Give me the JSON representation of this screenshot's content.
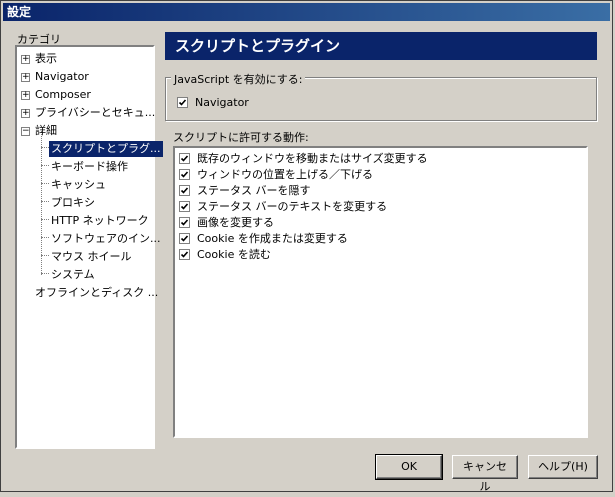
{
  "window": {
    "title": "設定"
  },
  "category_label": "カテゴリ",
  "tree": {
    "items": [
      {
        "label": "表示",
        "expander": "+"
      },
      {
        "label": "Navigator",
        "expander": "+"
      },
      {
        "label": "Composer",
        "expander": "+"
      },
      {
        "label": "プライバシーとセキュ...",
        "expander": "+"
      },
      {
        "label": "詳細",
        "expander": "−"
      },
      {
        "label": "スクリプトとプラグ..."
      },
      {
        "label": "キーボード操作"
      },
      {
        "label": "キャッシュ"
      },
      {
        "label": "プロキシ"
      },
      {
        "label": "HTTP ネットワーク"
      },
      {
        "label": "ソフトウェアのイン..."
      },
      {
        "label": "マウス ホイール"
      },
      {
        "label": "システム"
      },
      {
        "label": "オフラインとディスク ..."
      }
    ]
  },
  "panel": {
    "title": "スクリプトとプラグイン",
    "js_group_label": "JavaScript を有効にする:",
    "navigator_checkbox": {
      "label": "Navigator",
      "checked": true
    },
    "allow_label": "スクリプトに許可する動作:",
    "options": [
      {
        "label": "既存のウィンドウを移動またはサイズ変更する",
        "checked": true
      },
      {
        "label": "ウィンドウの位置を上げる／下げる",
        "checked": true
      },
      {
        "label": "ステータス バーを隠す",
        "checked": true
      },
      {
        "label": "ステータス バーのテキストを変更する",
        "checked": true
      },
      {
        "label": "画像を変更する",
        "checked": true
      },
      {
        "label": "Cookie を作成または変更する",
        "checked": true
      },
      {
        "label": "Cookie を読む",
        "checked": true
      }
    ]
  },
  "buttons": {
    "ok": "OK",
    "cancel": "キャンセル",
    "help": "ヘルプ(H)"
  }
}
